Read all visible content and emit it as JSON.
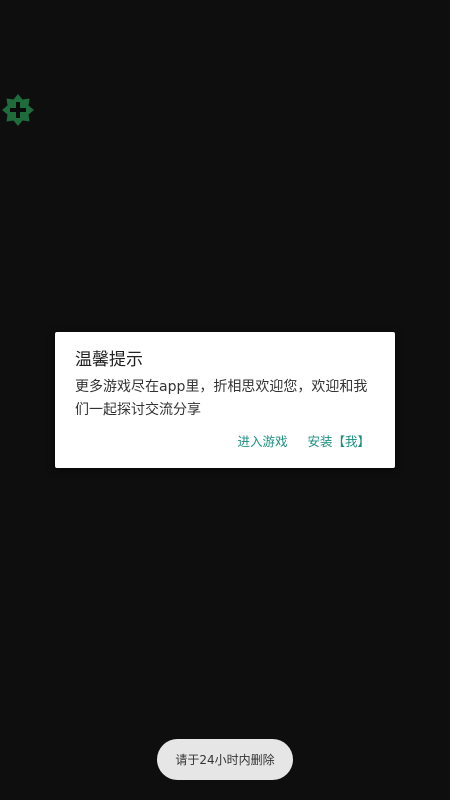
{
  "floating_button": {
    "icon": "plus-badge-icon",
    "color": "#1e6b3c"
  },
  "dialog": {
    "title": "温馨提示",
    "message": "更多游戏尽在app里，折相思欢迎您，欢迎和我们一起探讨交流分享",
    "buttons": {
      "enter_game": "进入游戏",
      "install": "安装【我】"
    },
    "accent_color": "#1a8f80"
  },
  "toast": {
    "text": "请于24小时内删除"
  }
}
